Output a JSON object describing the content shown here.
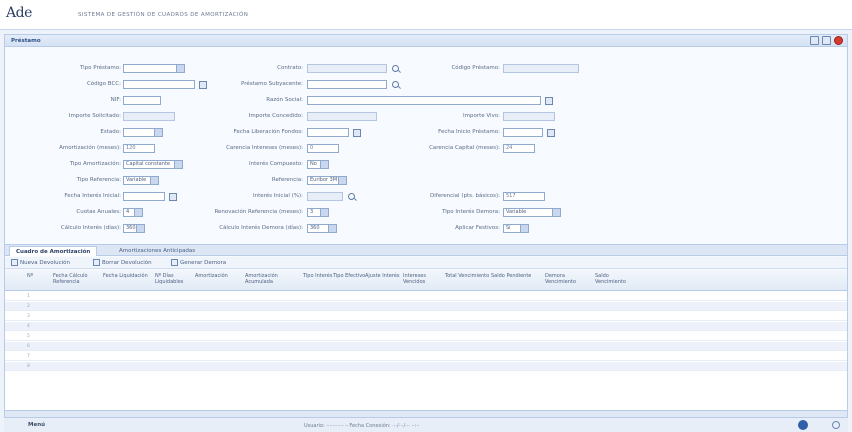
{
  "app": {
    "logo": "Ade",
    "title": "SISTEMA DE GESTIÓN DE CUADROS DE AMORTIZACIÓN"
  },
  "panel": {
    "title": "Préstamo"
  },
  "form": {
    "tipo_prestamo": {
      "label": "Tipo Préstamo:",
      "value": ""
    },
    "contrato": {
      "label": "Contrato:",
      "value": ""
    },
    "codigo_prestamo": {
      "label": "Código Préstamo:",
      "value": ""
    },
    "codigo_bcc": {
      "label": "Código BCC:",
      "value": ""
    },
    "prestamo_subyacente": {
      "label": "Préstamo Subyacente:",
      "value": ""
    },
    "nif": {
      "label": "NIF:",
      "value": ""
    },
    "razon_social": {
      "label": "Razón Social:",
      "value": ""
    },
    "importe_solicitado": {
      "label": "Importe Solicitado:",
      "value": ""
    },
    "importe_concedido": {
      "label": "Importe Concedido:",
      "value": ""
    },
    "importe_vivo": {
      "label": "Importe Vivo:",
      "value": ""
    },
    "estado": {
      "label": "Estado:",
      "value": ""
    },
    "fecha_liberacion": {
      "label": "Fecha Liberación Fondos:",
      "value": ""
    },
    "fecha_inicio": {
      "label": "Fecha Inicio Préstamo:",
      "value": ""
    },
    "amortizacion_meses": {
      "label": "Amortización (meses):",
      "value": "120"
    },
    "carencia_intereses": {
      "label": "Carencia Intereses (meses):",
      "value": "0"
    },
    "carencia_capital": {
      "label": "Carencia Capital (meses):",
      "value": "24"
    },
    "tipo_amortizacion": {
      "label": "Tipo Amortización:",
      "value": "Capital constante"
    },
    "interes_compuesto": {
      "label": "Interés Compuesto:",
      "value": "No"
    },
    "tipo_referencia": {
      "label": "Tipo Referencia:",
      "value": "Variable"
    },
    "referencia": {
      "label": "Referencia:",
      "value": "Euribor 3M"
    },
    "fecha_interes_inicial": {
      "label": "Fecha Interés Inicial:",
      "value": ""
    },
    "interes_inicial": {
      "label": "Interés Inicial (%):",
      "value": ""
    },
    "diferencial": {
      "label": "Diferencial (pts. básicos):",
      "value": "517"
    },
    "cuotas_anuales": {
      "label": "Cuotas Anuales:",
      "value": "4"
    },
    "renovacion_referencia": {
      "label": "Renovación Referencia (meses):",
      "value": "3"
    },
    "tipo_interes_demora": {
      "label": "Tipo Interés Demora:",
      "value": "Variable"
    },
    "calculo_interes": {
      "label": "Cálculo Interés (días):",
      "value": "360"
    },
    "calculo_interes_demora": {
      "label": "Cálculo Interés Demora (días):",
      "value": "360"
    },
    "aplicar_festivos": {
      "label": "Aplicar Festivos:",
      "value": "Sí"
    }
  },
  "tabs": [
    {
      "label": "Cuadro de Amortización"
    },
    {
      "label": "Amortizaciones Anticipadas"
    }
  ],
  "toolbar": {
    "new_devolution": "Nueva Devolución",
    "delete_devolution": "Borrar Devolución",
    "generate_demora": "Generar Demora"
  },
  "grid": {
    "columns": [
      "Nº",
      "Fecha Cálculo Referencia",
      "Fecha Liquidación",
      "Nº Días Liquidables",
      "Amortización",
      "Amortización Acumulada",
      "Tipo Interés",
      "Tipo Efectivo",
      "Ajuste Interés",
      "Intereses Vencidos",
      "Total Vencimiento",
      "Saldo Pendiente",
      "Demora Vencimiento",
      "Saldo Vencimiento"
    ],
    "rows": [
      [
        "1",
        "",
        "",
        "",
        "",
        "",
        "",
        "",
        "",
        "",
        "",
        "",
        "",
        ""
      ],
      [
        "2",
        "",
        "",
        "",
        "",
        "",
        "",
        "",
        "",
        "",
        "",
        "",
        "",
        ""
      ],
      [
        "3",
        "",
        "",
        "",
        "",
        "",
        "",
        "",
        "",
        "",
        "",
        "",
        "",
        ""
      ],
      [
        "4",
        "",
        "",
        "",
        "",
        "",
        "",
        "",
        "",
        "",
        "",
        "",
        "",
        ""
      ],
      [
        "5",
        "",
        "",
        "",
        "",
        "",
        "",
        "",
        "",
        "",
        "",
        "",
        "",
        ""
      ],
      [
        "6",
        "",
        "",
        "",
        "",
        "",
        "",
        "",
        "",
        "",
        "",
        "",
        "",
        ""
      ],
      [
        "7",
        "",
        "",
        "",
        "",
        "",
        "",
        "",
        "",
        "",
        "",
        "",
        "",
        ""
      ],
      [
        "8",
        "",
        "",
        "",
        "",
        "",
        "",
        "",
        "",
        "",
        "",
        "",
        "",
        ""
      ]
    ]
  },
  "status": {
    "menu_label": "Menú",
    "user_info": "Usuario: ··········· – Fecha Conexión: ···/···/··· ··:··"
  },
  "icons": {
    "lookup": "magnifier-icon",
    "calendar": "calendar-icon",
    "help": "help-icon",
    "close": "close-icon"
  }
}
